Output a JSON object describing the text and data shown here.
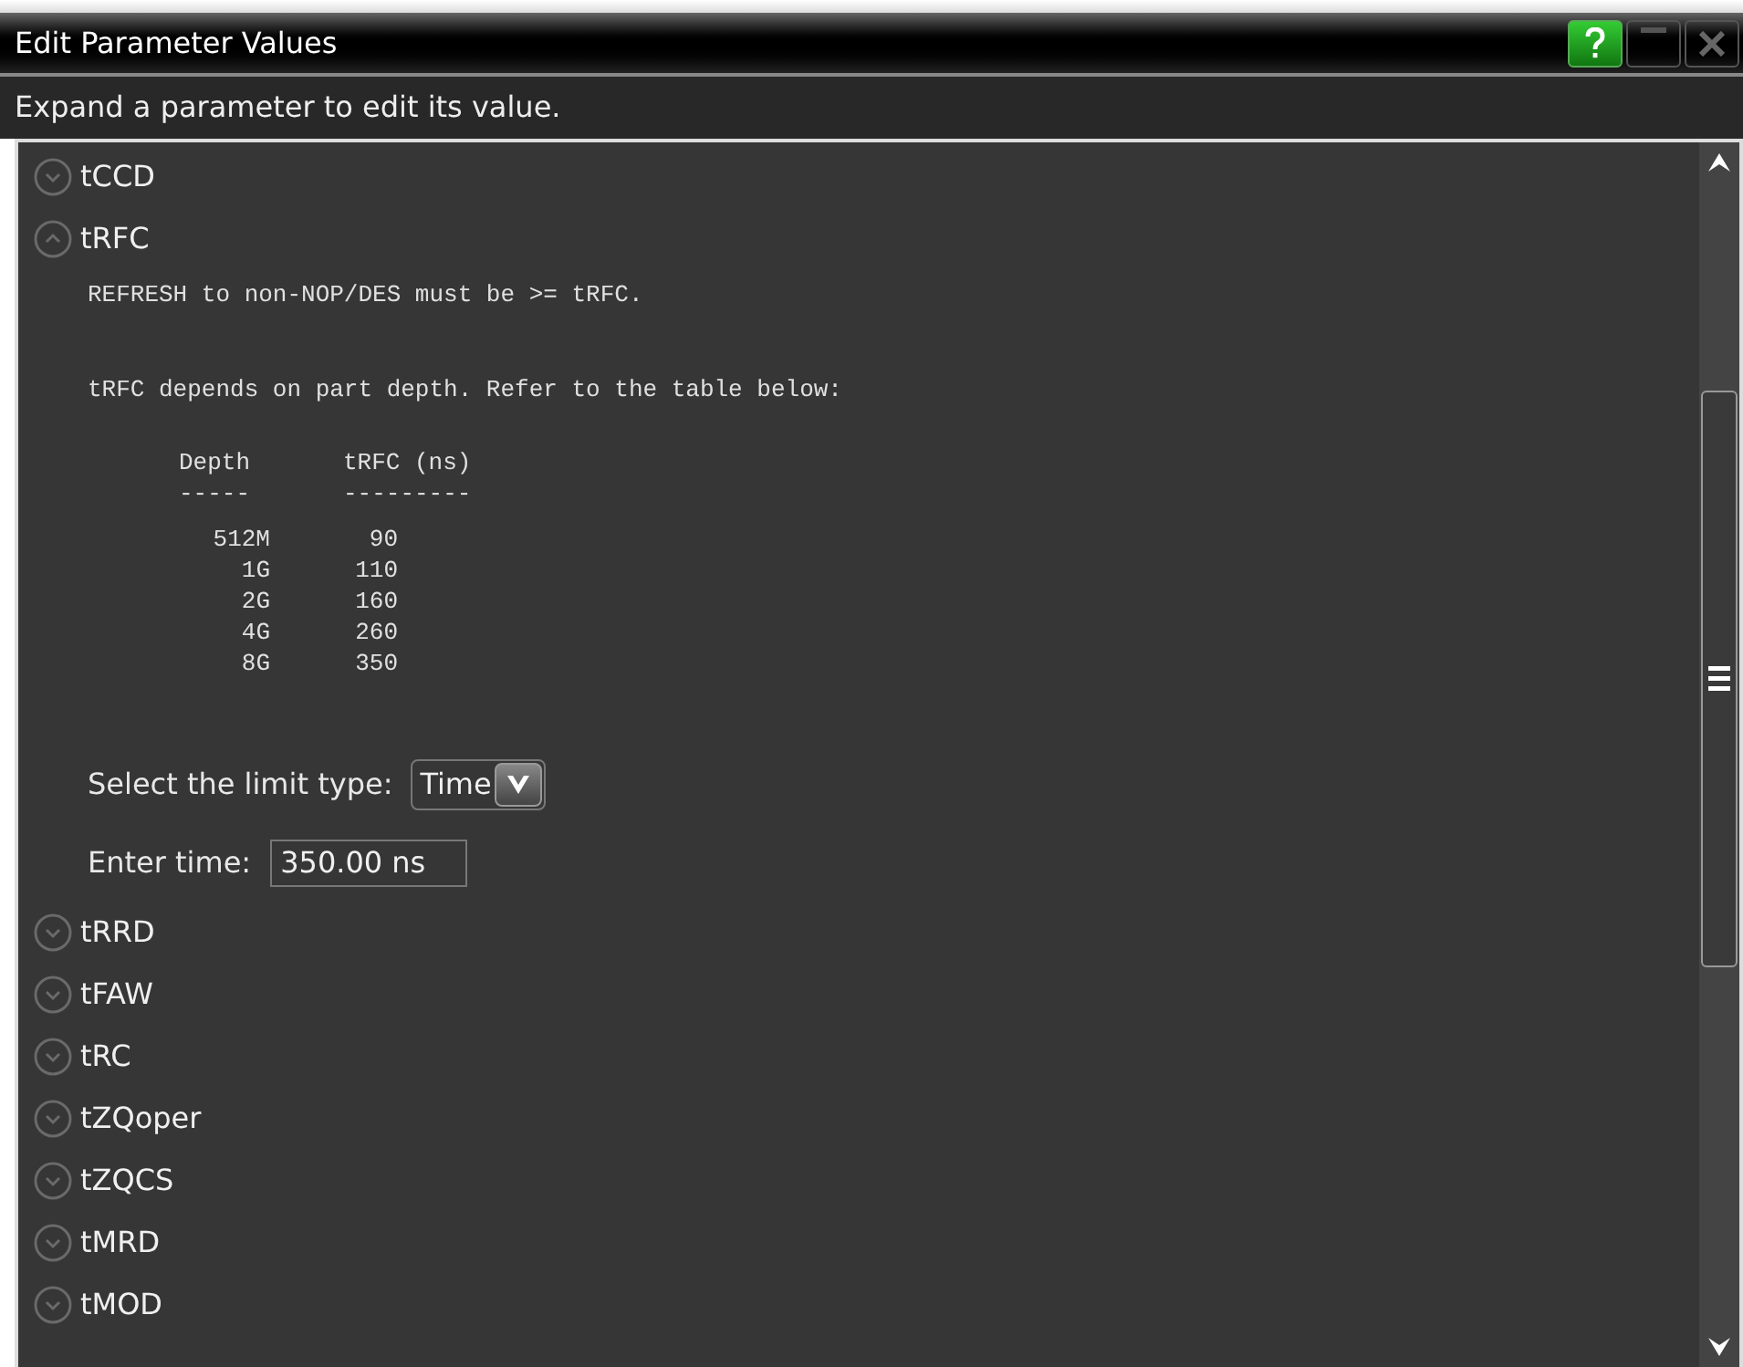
{
  "window": {
    "title": "Edit Parameter Values"
  },
  "instruction": "Expand a parameter to edit its value.",
  "parameters": [
    {
      "name": "tCCD",
      "expanded": false
    },
    {
      "name": "tRFC",
      "expanded": true,
      "details": {
        "lines": [
          "REFRESH to non-NOP/DES must be >= tRFC.",
          "tRFC depends on part depth. Refer to the table below:"
        ],
        "table": {
          "columns": [
            "Depth",
            "tRFC (ns)"
          ],
          "rules": [
            "-----",
            "---------"
          ],
          "rows": [
            [
              "512M",
              "90"
            ],
            [
              "1G",
              "110"
            ],
            [
              "2G",
              "160"
            ],
            [
              "4G",
              "260"
            ],
            [
              "8G",
              "350"
            ]
          ]
        },
        "limit_label": "Select the limit type:",
        "limit_value": "Time",
        "time_label": "Enter time:",
        "time_value": "350.00 ns"
      }
    },
    {
      "name": "tRRD",
      "expanded": false
    },
    {
      "name": "tFAW",
      "expanded": false
    },
    {
      "name": "tRC",
      "expanded": false
    },
    {
      "name": "tZQoper",
      "expanded": false
    },
    {
      "name": "tZQCS",
      "expanded": false
    },
    {
      "name": "tMRD",
      "expanded": false
    },
    {
      "name": "tMOD",
      "expanded": false
    }
  ]
}
